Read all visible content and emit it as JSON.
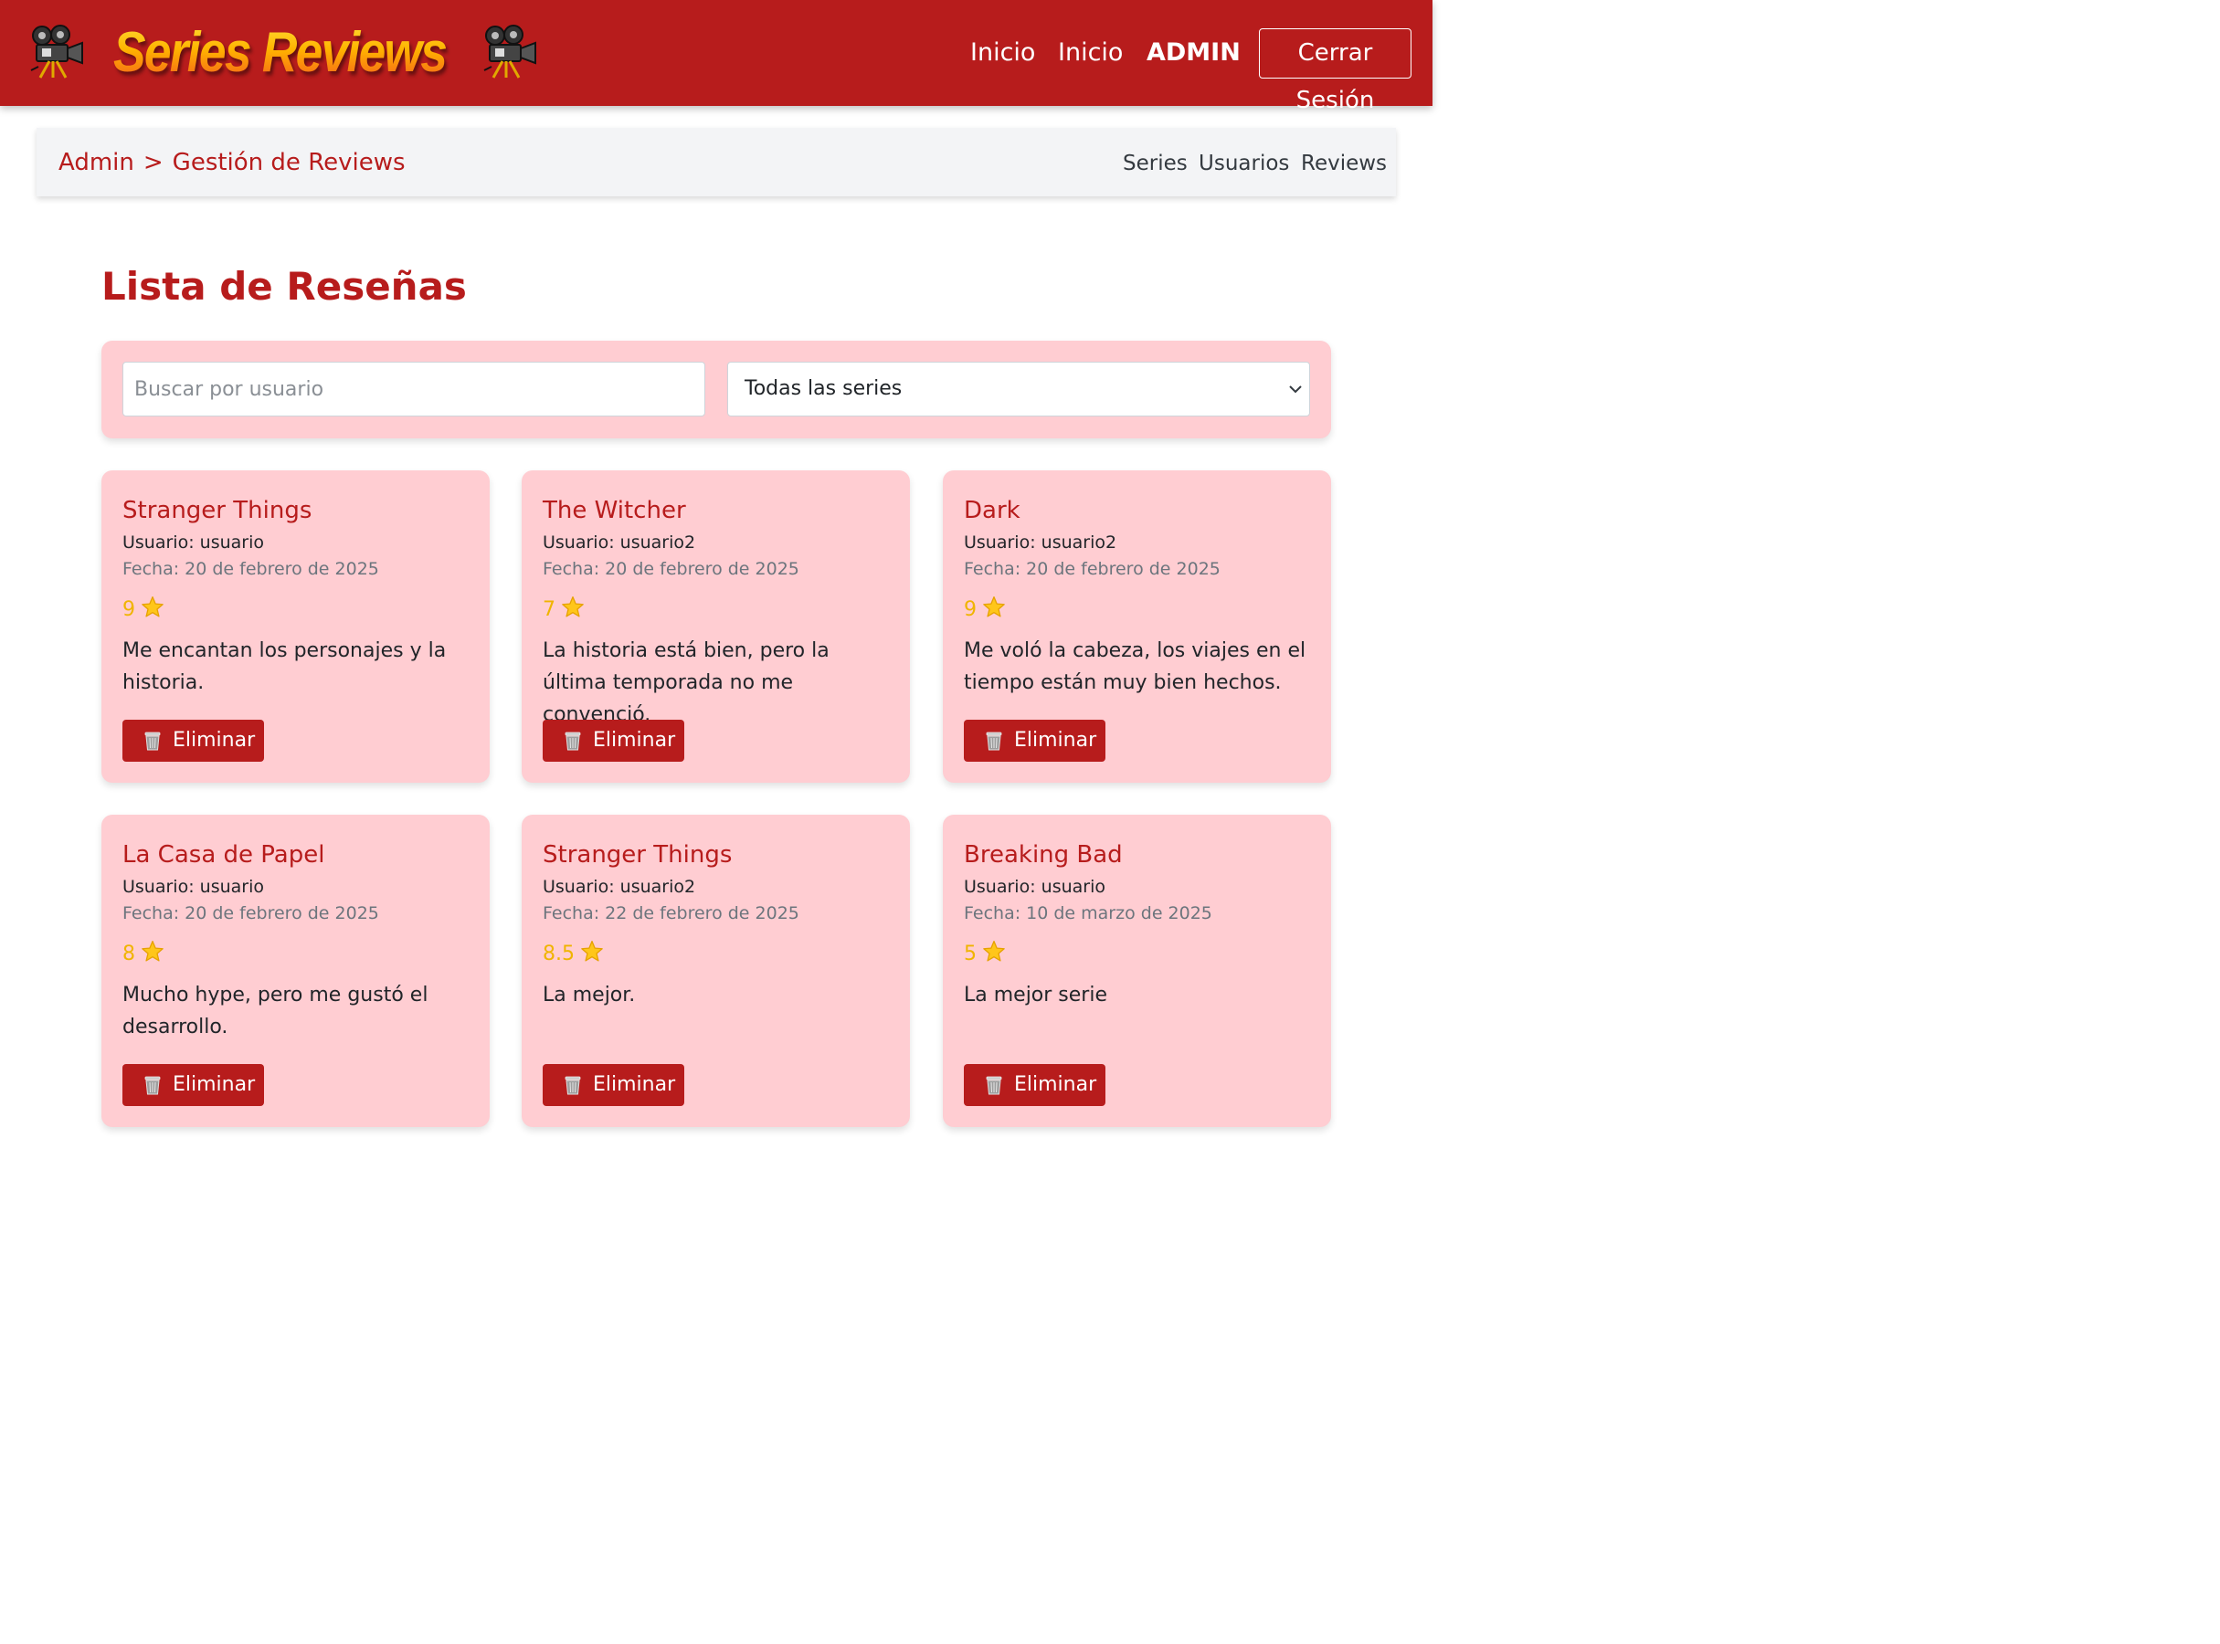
{
  "brand": {
    "title": "Series Reviews",
    "left_icon": "movie-camera-icon",
    "right_icon": "movie-camera-icon"
  },
  "nav": {
    "inicio_1": "Inicio",
    "inicio_2": "Inicio",
    "admin": "ADMIN",
    "logout": "Cerrar Sesión"
  },
  "subnav": {
    "crumb_root": "Admin",
    "crumb_sep": ">",
    "crumb_current": "Gestión de Reviews",
    "links": [
      "Series",
      "Usuarios",
      "Reviews"
    ]
  },
  "page": {
    "title": "Lista de Reseñas"
  },
  "filters": {
    "search_placeholder": "Buscar por usuario",
    "series_selected": "Todas las series"
  },
  "reviews": [
    {
      "series": "Stranger Things",
      "user": "Usuario: usuario",
      "date": "Fecha: 20 de febrero de 2025",
      "rating": "9",
      "comment": "Me encantan los personajes y la historia.",
      "delete": "Eliminar"
    },
    {
      "series": "The Witcher",
      "user": "Usuario: usuario2",
      "date": "Fecha: 20 de febrero de 2025",
      "rating": "7",
      "comment": "La historia está bien, pero la última temporada no me convenció.",
      "delete": "Eliminar"
    },
    {
      "series": "Dark",
      "user": "Usuario: usuario2",
      "date": "Fecha: 20 de febrero de 2025",
      "rating": "9",
      "comment": "Me voló la cabeza, los viajes en el tiempo están muy bien hechos.",
      "delete": "Eliminar"
    },
    {
      "series": "La Casa de Papel",
      "user": "Usuario: usuario",
      "date": "Fecha: 20 de febrero de 2025",
      "rating": "8",
      "comment": "Mucho hype, pero me gustó el desarrollo.",
      "delete": "Eliminar"
    },
    {
      "series": "Stranger Things",
      "user": "Usuario: usuario2",
      "date": "Fecha: 22 de febrero de 2025",
      "rating": "8.5",
      "comment": "La mejor.",
      "delete": "Eliminar"
    },
    {
      "series": "Breaking Bad",
      "user": "Usuario: usuario",
      "date": "Fecha: 10 de marzo de 2025",
      "rating": "5",
      "comment": "La mejor serie",
      "delete": "Eliminar"
    }
  ],
  "colors": {
    "primary": "#b71c1c",
    "card_bg": "#ffcdd2",
    "star": "#f0b400"
  }
}
